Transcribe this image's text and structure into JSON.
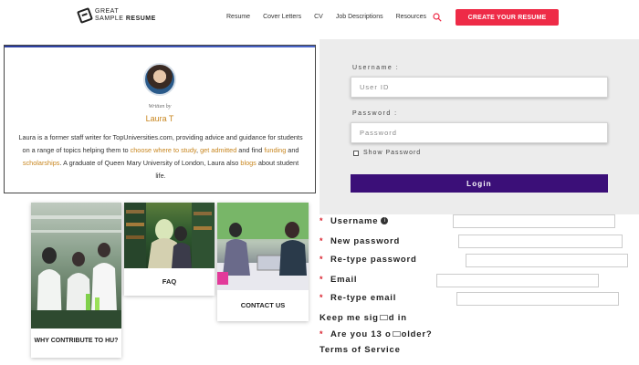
{
  "header": {
    "logo_line1": "GREAT",
    "logo_line2_a": "SAMPLE ",
    "logo_line2_b": "RESUME",
    "nav": [
      "Resume",
      "Cover Letters",
      "CV",
      "Job Descriptions",
      "Resources"
    ],
    "cta_label": "CREATE YOUR RESUME",
    "accent_color": "#ee2b47"
  },
  "author": {
    "written_by": "Written by",
    "name": "Laura T",
    "bio_parts": [
      {
        "text": "Laura is a former staff writer for TopUniversities.com, providing advice and guidance for students on a range of topics helping them to ",
        "highlight": false
      },
      {
        "text": "choose where to study",
        "highlight": true
      },
      {
        "text": ", ",
        "highlight": false
      },
      {
        "text": "get admitted",
        "highlight": true
      },
      {
        "text": " and find ",
        "highlight": false
      },
      {
        "text": "funding",
        "highlight": true
      },
      {
        "text": " and ",
        "highlight": false
      },
      {
        "text": "scholarships",
        "highlight": true
      },
      {
        "text": ". A graduate of Queen Mary University of London, Laura also ",
        "highlight": false
      },
      {
        "text": "blogs",
        "highlight": true
      },
      {
        "text": " about student life.",
        "highlight": false
      }
    ],
    "highlight_color": "#c8861f"
  },
  "login": {
    "username_label": "Username :",
    "username_placeholder": "User ID",
    "password_label": "Password :",
    "password_placeholder": "Password",
    "show_password_label": "Show Password",
    "login_button": "Login",
    "button_color": "#3b0f78"
  },
  "tiles": [
    {
      "caption": "WHY CONTRIBUTE TO HU?"
    },
    {
      "caption": "FAQ"
    },
    {
      "caption": "CONTACT US"
    }
  ],
  "registration": {
    "fields": [
      {
        "label": "Username",
        "required": true,
        "info_icon": true
      },
      {
        "label": "New password",
        "required": true
      },
      {
        "label": "Re-type password",
        "required": true
      },
      {
        "label": "Email",
        "required": true
      },
      {
        "label": "Re-type email",
        "required": true
      }
    ],
    "keep_signed_in_a": "Keep me sig",
    "keep_signed_in_b": "d in",
    "age_question_a": "Are you 13 o",
    "age_question_b": "older?",
    "terms": "Terms of Service",
    "required_color": "#d9232f"
  }
}
